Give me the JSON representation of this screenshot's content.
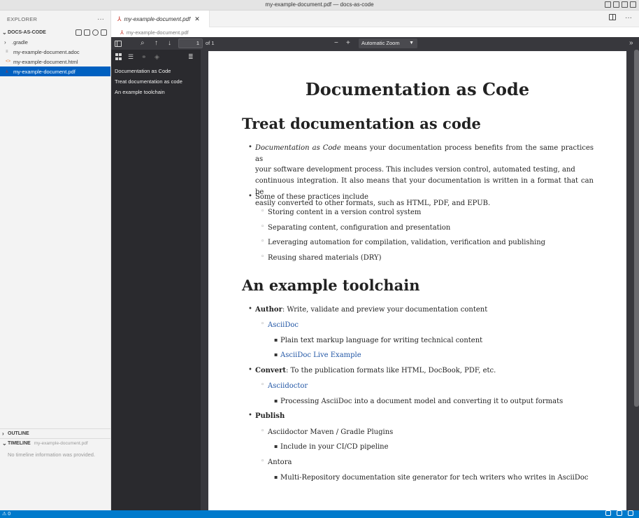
{
  "window": {
    "title": "my-example-document.pdf — docs-as-code"
  },
  "explorer": {
    "header": "EXPLORER",
    "more": "···",
    "project": "DOCS-AS-CODE",
    "items": [
      {
        "label": ".gradle",
        "type": "folder"
      },
      {
        "label": "my-example-document.adoc",
        "type": "adoc"
      },
      {
        "label": "my-example-document.html",
        "type": "html"
      },
      {
        "label": "my-example-document.pdf",
        "type": "pdf",
        "selected": true
      }
    ],
    "outline_label": "OUTLINE",
    "timeline_label": "TIMELINE",
    "timeline_file": "my-example-document.pdf",
    "timeline_message": "No timeline information was provided."
  },
  "editor": {
    "tab_label": "my-example-document.pdf",
    "breadcrumb": "my-example-document.pdf"
  },
  "pdf_toolbar": {
    "page_number": "1",
    "page_total": "of 1",
    "zoom": "Automatic Zoom"
  },
  "pdf_outline": [
    "Documentation as Code",
    "Treat documentation as code",
    "An example toolchain"
  ],
  "document": {
    "title": "Documentation as Code",
    "h2_1": "Treat documentation as code",
    "intro_em": "Documentation as Code",
    "intro_rest_1": " means your documentation process benefits from the same practices as",
    "intro_line2": "your software development process. This includes version control, automated testing, and",
    "intro_line3": "continuous integration. It also means that your documentation is written in a format that can be",
    "intro_line4": "easily converted to other formats, such as HTML, PDF, and EPUB.",
    "practices_intro": "Some of these practices include",
    "practices": [
      "Storing content in a version control system",
      "Separating content, configuration and presentation",
      "Leveraging automation for compilation, validation, verification and publishing",
      "Reusing shared materials (DRY)"
    ],
    "h2_2": "An example toolchain",
    "author_label": "Author",
    "author_text": ": Write, validate and preview your documentation content",
    "asciidoc_link": "AsciiDoc",
    "asciidoc_desc": "Plain text markup language for writing technical content",
    "asciidoc_live": "AsciiDoc Live Example",
    "convert_label": "Convert",
    "convert_text": ": To the publication formats like HTML, DocBook, PDF, etc.",
    "asciidoctor_link": "Asciidoctor",
    "asciidoctor_desc": "Processing AsciiDoc into a document model and converting it to output formats",
    "publish_label": "Publish",
    "plugins": "Asciidoctor Maven / Gradle Plugins",
    "plugins_desc": "Include in your CI/CD pipeline",
    "antora": "Antora",
    "antora_desc": "Multi-Repository documentation site generator for tech writers who writes in AsciiDoc"
  },
  "statusbar": {
    "left": "0"
  },
  "colors": {
    "accent": "#007acc",
    "selection": "#0060c0",
    "link": "#2156a5",
    "pdf_bg": "#38383d"
  }
}
